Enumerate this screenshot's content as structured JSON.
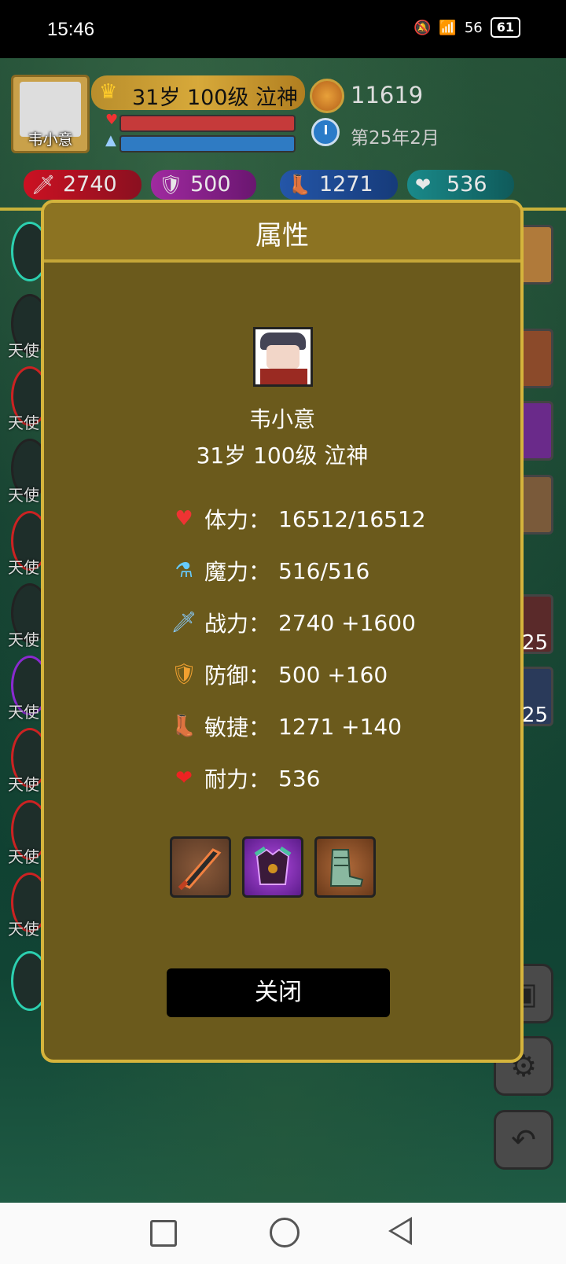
{
  "status_bar": {
    "time": "15:46",
    "network": "56",
    "battery": "61"
  },
  "header": {
    "avatar_name": "韦小意",
    "level_info": "31岁 100级 泣神",
    "gold": "11619",
    "date": "第25年2月",
    "stats": {
      "attack": "2740",
      "defense": "500",
      "agility": "1271",
      "endurance": "536"
    }
  },
  "side": {
    "angel_label": "天使",
    "potion_count_red": "25",
    "potion_count_blue": "25"
  },
  "dialog": {
    "title": "属性",
    "char_name": "韦小意",
    "char_level": "31岁 100级 泣神",
    "attributes": [
      {
        "label": "体力：",
        "value": "16512/16512",
        "icon": "heart-icon"
      },
      {
        "label": "魔力：",
        "value": "516/516",
        "icon": "mana-potion-icon"
      },
      {
        "label": "战力：",
        "value": "2740 +1600",
        "icon": "sword-icon"
      },
      {
        "label": "防御：",
        "value": "500 +160",
        "icon": "shield-icon"
      },
      {
        "label": "敏捷：",
        "value": "1271 +140",
        "icon": "boot-icon"
      },
      {
        "label": "耐力：",
        "value": "536",
        "icon": "heart-plus-icon"
      }
    ],
    "equipment": [
      "sword-equip-icon",
      "armor-equip-icon",
      "boots-equip-icon"
    ],
    "close_label": "关闭"
  }
}
